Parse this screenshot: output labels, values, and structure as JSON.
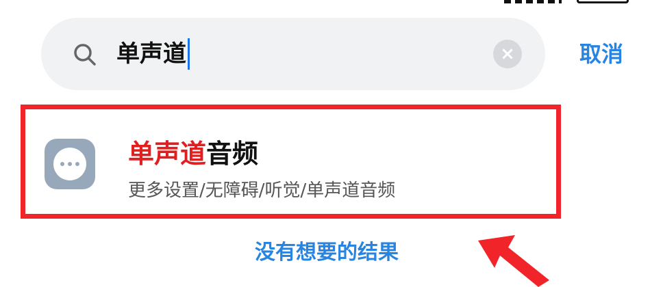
{
  "search": {
    "query": "单声道"
  },
  "actions": {
    "clear_symbol": "×",
    "cancel_label": "取消"
  },
  "result": {
    "title_highlight": "单声道",
    "title_rest": "音频",
    "path": "更多设置/无障碍/听觉/单声道音频"
  },
  "footer": {
    "no_result_label": "没有想要的结果"
  },
  "colors": {
    "accent": "#2784e0",
    "highlight": "#e02020",
    "frame": "#f1242a"
  }
}
